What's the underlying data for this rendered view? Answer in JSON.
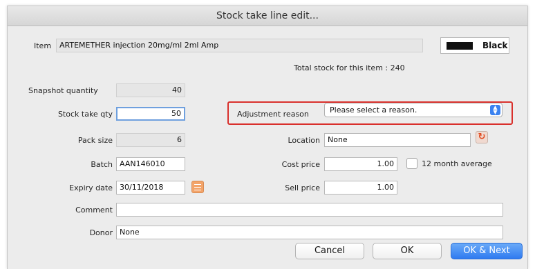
{
  "window": {
    "title": "Stock take line edit..."
  },
  "item": {
    "label": "Item",
    "value": "ARTEMETHER injection 20mg/ml 2ml Amp"
  },
  "color": {
    "name": "Black",
    "swatch": "#111111"
  },
  "total_stock": "Total stock for this item : 240",
  "snapshot": {
    "label": "Snapshot quantity",
    "value": "40"
  },
  "stock_take": {
    "label": "Stock take qty",
    "value": "50"
  },
  "pack_size": {
    "label": "Pack size",
    "value": "6"
  },
  "batch": {
    "label": "Batch",
    "value": "AAN146010"
  },
  "expiry": {
    "label": "Expiry date",
    "value": "30/11/2018"
  },
  "adjustment": {
    "label": "Adjustment reason",
    "value": "Please select a reason."
  },
  "location": {
    "label": "Location",
    "value": "None"
  },
  "cost_price": {
    "label": "Cost price",
    "value": "1.00"
  },
  "sell_price": {
    "label": "Sell price",
    "value": "1.00"
  },
  "twelve_month": {
    "label": "12 month average"
  },
  "comment": {
    "label": "Comment",
    "value": ""
  },
  "donor": {
    "label": "Donor",
    "value": "None"
  },
  "buttons": {
    "cancel": "Cancel",
    "ok": "OK",
    "ok_next": "OK & Next"
  },
  "accent": {
    "highlight": "#d9302c",
    "primary": "#2f7bf0"
  }
}
